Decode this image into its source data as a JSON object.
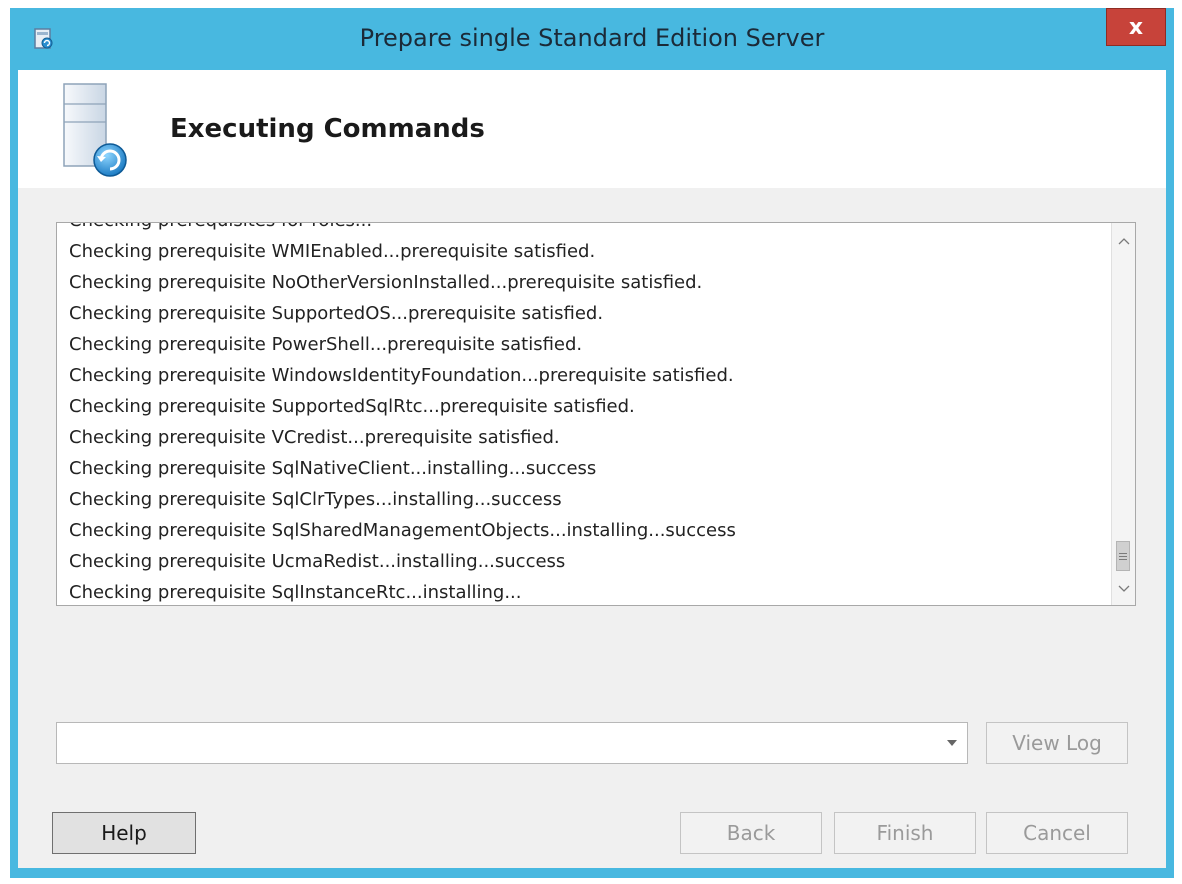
{
  "window": {
    "title": "Prepare single Standard Edition Server",
    "close_label": "x"
  },
  "header": {
    "title": "Executing Commands"
  },
  "log": {
    "lines": [
      "Checking prerequisites for roles...",
      "Checking prerequisite WMIEnabled...prerequisite satisfied.",
      "Checking prerequisite NoOtherVersionInstalled...prerequisite satisfied.",
      "Checking prerequisite SupportedOS...prerequisite satisfied.",
      "Checking prerequisite PowerShell...prerequisite satisfied.",
      "Checking prerequisite WindowsIdentityFoundation...prerequisite satisfied.",
      "Checking prerequisite SupportedSqlRtc...prerequisite satisfied.",
      "Checking prerequisite VCredist...prerequisite satisfied.",
      "Checking prerequisite SqlNativeClient...installing...success",
      "Checking prerequisite SqlClrTypes...installing...success",
      "Checking prerequisite SqlSharedManagementObjects...installing...success",
      "Checking prerequisite UcmaRedist...installing...success",
      "Checking prerequisite SqlInstanceRtc...installing..."
    ]
  },
  "combo": {
    "value": ""
  },
  "buttons": {
    "view_log": "View Log",
    "help": "Help",
    "back": "Back",
    "finish": "Finish",
    "cancel": "Cancel"
  },
  "icons": {
    "app": "setup-icon",
    "header": "server-refresh-icon",
    "scroll_up": "chevron-up-icon",
    "scroll_down": "chevron-down-icon",
    "combo_arrow": "dropdown-arrow-icon"
  },
  "colors": {
    "frame": "#48b8e0",
    "close": "#c7433a"
  }
}
